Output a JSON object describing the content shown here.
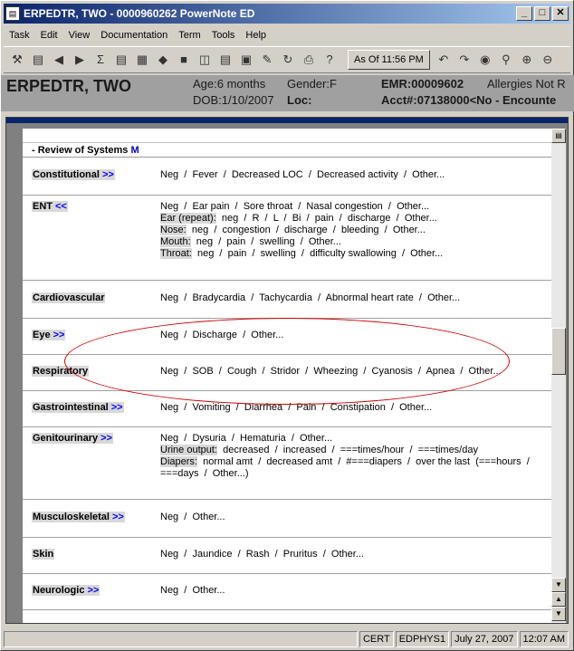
{
  "window": {
    "title": "ERPEDTR, TWO - 0000960262 PowerNote ED"
  },
  "menu": [
    "Task",
    "Edit",
    "View",
    "Documentation",
    "Term",
    "Tools",
    "Help"
  ],
  "toolbar": {
    "as_of": "As Of 11:56 PM"
  },
  "banner": {
    "name": "ERPEDTR, TWO",
    "age": "Age:6 months",
    "dob": "DOB:1/10/2007",
    "gender": "Gender:F",
    "loc": "Loc:",
    "emr": "EMR:00009602",
    "allergies": "Allergies Not R",
    "acct": "Acct#:07138000<No - Encounte"
  },
  "document": {
    "section_title": "- Review of Systems",
    "section_marker": "M",
    "rows": [
      {
        "label": "Constitutional",
        "arrow": ">>",
        "lines": [
          {
            "prefix": "",
            "text": "Neg  /  Fever  /  Decreased LOC  /  Decreased activity  /  Other..."
          }
        ]
      },
      {
        "label": "ENT",
        "arrow": "<<",
        "lines": [
          {
            "prefix": "",
            "text": "Neg  /  Ear pain  /  Sore throat  /  Nasal congestion  /  Other..."
          },
          {
            "prefix": "Ear (repeat):",
            "text": "  neg  /  R  /  L  /  Bi  /  pain  /  discharge  /  Other..."
          },
          {
            "prefix": "Nose:",
            "text": "  neg  /  congestion  /  discharge  /  bleeding  /  Other..."
          },
          {
            "prefix": "Mouth:",
            "text": "  neg  /  pain  /  swelling  /  Other..."
          },
          {
            "prefix": "Throat:",
            "text": "  neg  /  pain  /  swelling  /  difficulty swallowing  /  Other..."
          }
        ]
      },
      {
        "label": "Cardiovascular",
        "arrow": "",
        "lines": [
          {
            "prefix": "",
            "text": "Neg  /  Bradycardia  /  Tachycardia  /  Abnormal heart rate  /  Other..."
          }
        ]
      },
      {
        "label": "Eye",
        "arrow": ">>",
        "lines": [
          {
            "prefix": "",
            "text": "Neg  /  Discharge  /  Other..."
          }
        ]
      },
      {
        "label": "Respiratory",
        "arrow": "",
        "lines": [
          {
            "prefix": "",
            "text": "Neg  /  SOB  /  Cough  /  Stridor  /  Wheezing  /  Cyanosis  /  Apnea  /  Other..."
          }
        ]
      },
      {
        "label": "Gastrointestinal",
        "arrow": ">>",
        "lines": [
          {
            "prefix": "",
            "text": "Neg  /  Vomiting  /  Diarrhea  /  Pain  /  Constipation  /  Other..."
          }
        ]
      },
      {
        "label": "Genitourinary",
        "arrow": ">>",
        "lines": [
          {
            "prefix": "",
            "text": "Neg  /  Dysuria  /  Hematuria  /  Other..."
          },
          {
            "prefix": "Urine output:",
            "text": "  decreased  /  increased  /  ===times/hour  /  ===times/day"
          },
          {
            "prefix": "Diapers:",
            "text": "  normal amt  /  decreased amt  /  #===diapers  /  over the last  (===hours  /"
          },
          {
            "prefix": "",
            "text": "===days  /  Other...)"
          }
        ]
      },
      {
        "label": "Musculoskeletal",
        "arrow": ">>",
        "lines": [
          {
            "prefix": "",
            "text": "Neg  /  Other..."
          }
        ]
      },
      {
        "label": "Skin",
        "arrow": "",
        "lines": [
          {
            "prefix": "",
            "text": "Neg  /  Jaundice  /  Rash  /  Pruritus  /  Other..."
          }
        ]
      },
      {
        "label": "Neurologic",
        "arrow": ">>",
        "lines": [
          {
            "prefix": "",
            "text": "Neg  /  Other..."
          }
        ]
      }
    ]
  },
  "status": {
    "env": "CERT",
    "user": "EDPHYS1",
    "date": "July 27, 2007",
    "time": "12:07 AM"
  },
  "colors": {
    "titlebar": "#0a246a",
    "link_arrow": "#0000ff",
    "highlight_ellipse": "#d00000"
  }
}
